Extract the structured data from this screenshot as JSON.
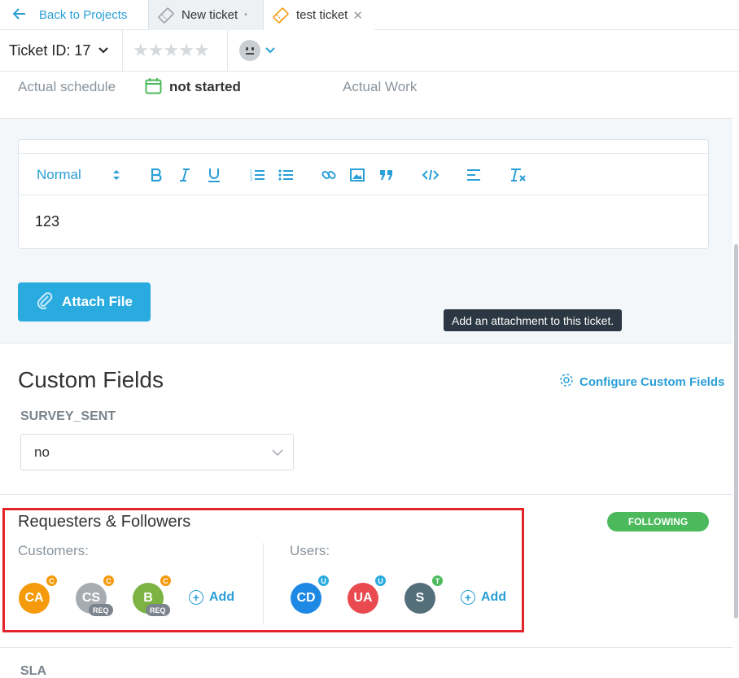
{
  "tabs": {
    "back_label": "Back to Projects",
    "items": [
      {
        "label": "New ticket",
        "marker": "•"
      },
      {
        "label": "test ticket",
        "close": "✕"
      }
    ]
  },
  "header": {
    "ticket_id": "Ticket ID: 17",
    "rating": {
      "stars_total": 5,
      "stars_filled": 0
    }
  },
  "schedule": {
    "actual_schedule_label": "Actual schedule",
    "status": "not started",
    "actual_work_label": "Actual Work"
  },
  "editor": {
    "format": "Normal",
    "content": "123"
  },
  "attach": {
    "button_label": "Attach File",
    "tooltip": "Add an attachment to this ticket."
  },
  "custom_fields": {
    "title": "Custom Fields",
    "configure_label": "Configure Custom Fields",
    "field_label": "SURVEY_SENT",
    "field_value": "no"
  },
  "requesters": {
    "title": "Requesters & Followers",
    "following_label": "FOLLOWING",
    "customers_label": "Customers:",
    "users_label": "Users:",
    "add_label": "Add",
    "customers": [
      {
        "initials": "CA",
        "badge": "C",
        "color": "#f49a0b",
        "req": ""
      },
      {
        "initials": "CS",
        "badge": "C",
        "color": "#a7acb1",
        "req": "REQ"
      },
      {
        "initials": "B",
        "badge": "C",
        "color": "#7cb342",
        "req": "REQ"
      }
    ],
    "users": [
      {
        "initials": "CD",
        "badge": "U",
        "color": "#1e88e5",
        "badge_color": "#29abe0"
      },
      {
        "initials": "UA",
        "badge": "U",
        "color": "#e84a4f",
        "badge_color": "#29abe0"
      },
      {
        "initials": "S",
        "badge": "T",
        "color": "#546e7a",
        "badge_color": "#4cba5c"
      }
    ]
  },
  "sla": {
    "label": "SLA"
  },
  "colors": {
    "accent": "#2a9fd6",
    "button": "#29abe0",
    "following": "#4cba5c",
    "highlight": "#e5232a",
    "customer_badge": "#f49a0b"
  }
}
